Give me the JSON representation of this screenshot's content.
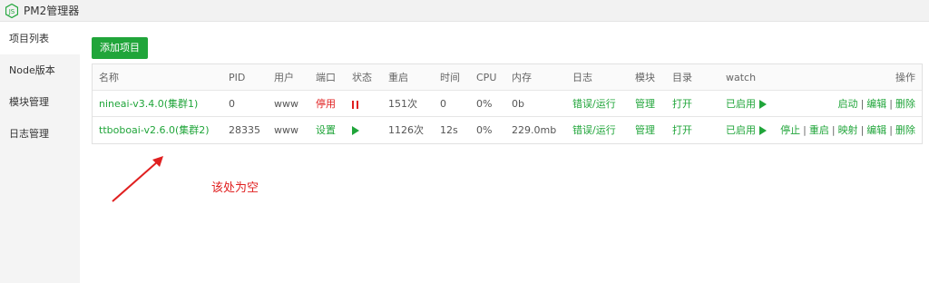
{
  "app": {
    "title": "PM2管理器",
    "logo_icon": "nodejs-logo",
    "accent": "#20a53a",
    "danger": "#e02020"
  },
  "sidebar": {
    "items": [
      {
        "label": "项目列表",
        "active": true
      },
      {
        "label": "Node版本",
        "active": false
      },
      {
        "label": "模块管理",
        "active": false
      },
      {
        "label": "日志管理",
        "active": false
      }
    ]
  },
  "toolbar": {
    "add_label": "添加项目"
  },
  "table": {
    "headers": {
      "name": "名称",
      "pid": "PID",
      "user": "用户",
      "port": "端口",
      "status": "状态",
      "restart": "重启",
      "time": "时间",
      "cpu": "CPU",
      "mem": "内存",
      "log": "日志",
      "module": "模块",
      "dir": "目录",
      "watch": "watch",
      "ops": "操作"
    },
    "rows": [
      {
        "name": "nineai-v3.4.0(集群1)",
        "pid": "0",
        "user": "www",
        "port": "停用",
        "status": "stopped",
        "restart": "151次",
        "time": "0",
        "cpu": "0%",
        "mem": "0b",
        "log": "错误/运行",
        "module": "管理",
        "dir": "打开",
        "watch": "已启用",
        "ops": [
          "启动",
          "编辑",
          "删除"
        ]
      },
      {
        "name": "ttboboai-v2.6.0(集群2)",
        "pid": "28335",
        "user": "www",
        "port": "设置",
        "status": "running",
        "restart": "1126次",
        "time": "12s",
        "cpu": "0%",
        "mem": "229.0mb",
        "log": "错误/运行",
        "module": "管理",
        "dir": "打开",
        "watch": "已启用",
        "ops": [
          "停止",
          "重启",
          "映射",
          "编辑",
          "删除"
        ]
      }
    ]
  },
  "annotation": {
    "text": "该处为空"
  }
}
